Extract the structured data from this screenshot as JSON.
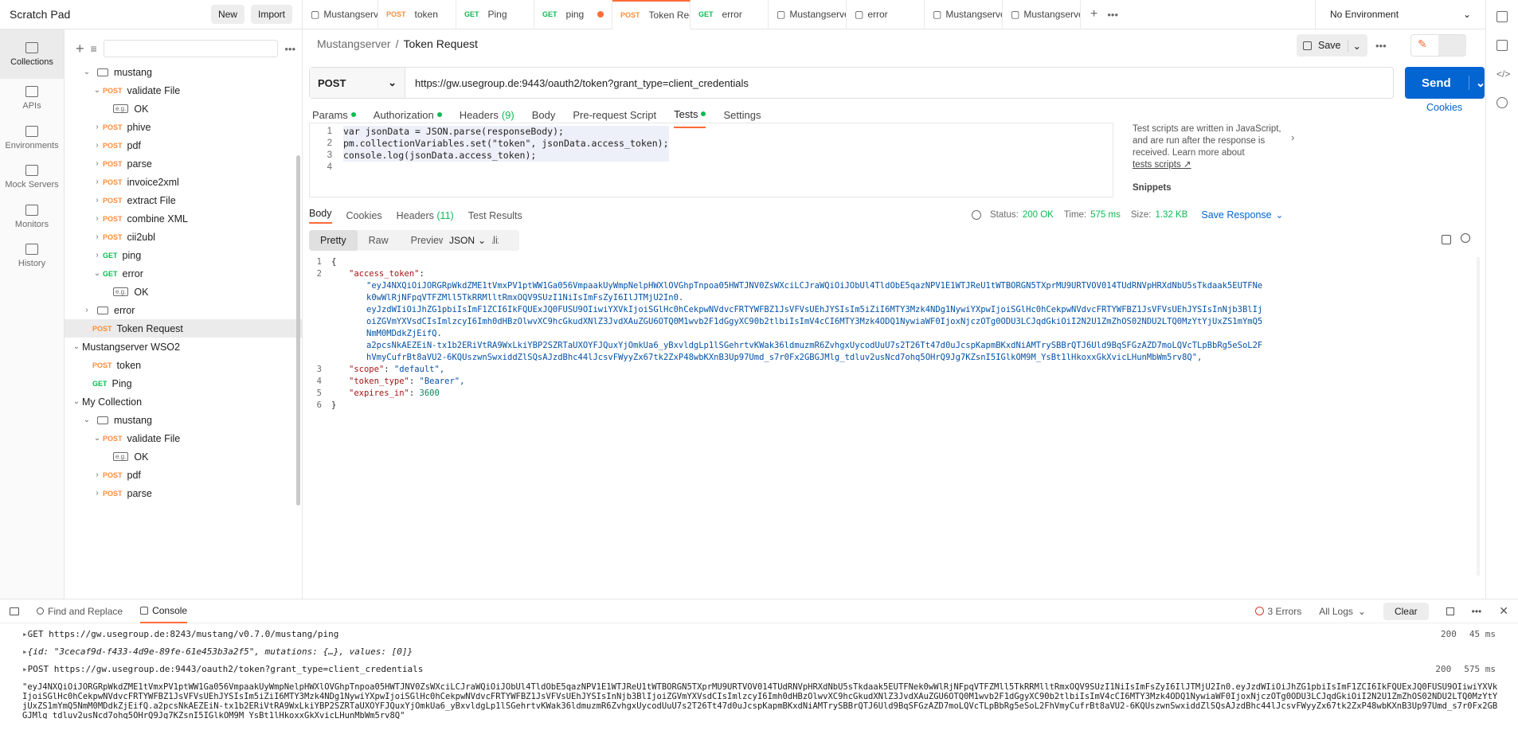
{
  "workspace": {
    "title": "Scratch Pad",
    "new_label": "New",
    "import_label": "Import"
  },
  "rail": [
    {
      "label": "Collections",
      "icon": "collections-icon"
    },
    {
      "label": "APIs",
      "icon": "apis-icon"
    },
    {
      "label": "Environments",
      "icon": "environments-icon"
    },
    {
      "label": "Mock Servers",
      "icon": "mock-servers-icon"
    },
    {
      "label": "Monitors",
      "icon": "monitors-icon"
    },
    {
      "label": "History",
      "icon": "history-icon"
    }
  ],
  "tree": [
    {
      "depth": 1,
      "chev": "v",
      "type": "folder",
      "label": "mustang"
    },
    {
      "depth": 2,
      "chev": "v",
      "method": "POST",
      "label": "validate File"
    },
    {
      "depth": 3,
      "chev": "",
      "type": "example",
      "label": "OK"
    },
    {
      "depth": 2,
      "chev": ">",
      "method": "POST",
      "label": "phive"
    },
    {
      "depth": 2,
      "chev": ">",
      "method": "POST",
      "label": "pdf"
    },
    {
      "depth": 2,
      "chev": ">",
      "method": "POST",
      "label": "parse"
    },
    {
      "depth": 2,
      "chev": ">",
      "method": "POST",
      "label": "invoice2xml"
    },
    {
      "depth": 2,
      "chev": ">",
      "method": "POST",
      "label": "extract File"
    },
    {
      "depth": 2,
      "chev": ">",
      "method": "POST",
      "label": "combine XML"
    },
    {
      "depth": 2,
      "chev": ">",
      "method": "POST",
      "label": "cii2ubl"
    },
    {
      "depth": 2,
      "chev": ">",
      "method": "GET",
      "label": "ping"
    },
    {
      "depth": 2,
      "chev": "v",
      "method": "GET",
      "label": "error"
    },
    {
      "depth": 3,
      "chev": "",
      "type": "example",
      "label": "OK"
    },
    {
      "depth": 1,
      "chev": ">",
      "type": "folder",
      "label": "error"
    },
    {
      "depth": 1,
      "chev": "",
      "method": "POST",
      "label": "Token Request",
      "selected": true
    },
    {
      "depth": 0,
      "chev": "v",
      "type": "collection",
      "label": "Mustangserver WSO2"
    },
    {
      "depth": 1,
      "chev": "",
      "method": "POST",
      "label": "token"
    },
    {
      "depth": 1,
      "chev": "",
      "method": "GET",
      "label": "Ping"
    },
    {
      "depth": 0,
      "chev": "v",
      "type": "collection",
      "label": "My Collection"
    },
    {
      "depth": 1,
      "chev": "v",
      "type": "folder",
      "label": "mustang"
    },
    {
      "depth": 2,
      "chev": "v",
      "method": "POST",
      "label": "validate File"
    },
    {
      "depth": 3,
      "chev": "",
      "type": "example",
      "label": "OK"
    },
    {
      "depth": 2,
      "chev": ">",
      "method": "POST",
      "label": "pdf"
    },
    {
      "depth": 2,
      "chev": ">",
      "method": "POST",
      "label": "parse"
    }
  ],
  "tabs": [
    {
      "method": "",
      "label": "Mustangserver",
      "icon": "collection-icon"
    },
    {
      "method": "POST",
      "label": "token"
    },
    {
      "method": "GET",
      "label": "Ping"
    },
    {
      "method": "GET",
      "label": "ping",
      "dot": true
    },
    {
      "method": "POST",
      "label": "Token Requ",
      "dot": true,
      "active": true
    },
    {
      "method": "GET",
      "label": "error"
    },
    {
      "method": "",
      "label": "Mustangserver",
      "icon": "collection-icon"
    },
    {
      "method": "",
      "label": "error",
      "icon": "folder-icon"
    },
    {
      "method": "",
      "label": "Mustangserver",
      "icon": "runner-icon"
    },
    {
      "method": "",
      "label": "Mustangserver",
      "icon": "runner-icon"
    }
  ],
  "environment": "No Environment",
  "breadcrumb": {
    "parent": "Mustangserver",
    "sep": "/",
    "current": "Token Request"
  },
  "save_label": "Save",
  "request": {
    "method": "POST",
    "url": "https://gw.usegroup.de:9443/oauth2/token?grant_type=client_credentials",
    "send_label": "Send"
  },
  "req_tabs": [
    {
      "label": "Params",
      "dot": true
    },
    {
      "label": "Authorization",
      "dot": true
    },
    {
      "label": "Headers",
      "count": "(9)"
    },
    {
      "label": "Body"
    },
    {
      "label": "Pre-request Script"
    },
    {
      "label": "Tests",
      "dot": true,
      "active": true
    },
    {
      "label": "Settings"
    }
  ],
  "cookies_label": "Cookies",
  "tests_code": [
    "var jsonData = JSON.parse(responseBody);",
    "pm.collectionVariables.set(\"token\", jsonData.access_token);",
    "console.log(jsonData.access_token);",
    ""
  ],
  "help": {
    "text": "Test scripts are written in JavaScript, and are run after the response is received. Learn more about",
    "link": "tests scripts ↗",
    "snippets": "Snippets"
  },
  "resp_tabs": [
    {
      "label": "Body",
      "active": true
    },
    {
      "label": "Cookies"
    },
    {
      "label": "Headers",
      "count": "(11)"
    },
    {
      "label": "Test Results"
    }
  ],
  "status": {
    "status_label": "Status:",
    "status": "200 OK",
    "time_label": "Time:",
    "time": "575 ms",
    "size_label": "Size:",
    "size": "1.32 KB",
    "save_resp": "Save Response"
  },
  "view_modes": [
    "Pretty",
    "Raw",
    "Preview",
    "Visualize"
  ],
  "format": "JSON",
  "response_lines": [
    {
      "n": "1",
      "text": "{"
    },
    {
      "n": "2",
      "key": "\"access_token\"",
      "value": ""
    },
    {
      "n": "",
      "value": "\"eyJ4NXQiOiJORGRpWkdZME1tVmxPV1ptWW1Ga056VmpaakUyWmpNelpHWXlOVGhpTnpoa05HWTJNV0ZsWXciLCJraWQiOiJObUl4TldObE5qazNPV1E1WTJReU1tWTBORGN5TXprMU9URTVOV014TUdRNVpHRXdNbU5sTkdaak5EUTFNek0wWlRjNFpqVTFZMll5TkRRMlltRmxOQV9SUzI1NiIsImFsZyI6IlJTMjU2In0."
    },
    {
      "n": "",
      "value": "eyJzdWIiOiJhZG1pbiIsImF1ZCI6IkFQUExJQ0FUSU9OIiwiYXVkIjoiSGlHc0hCekpwNVdvcFRTYWFBZ1JsVFVsUEhJYSIsIm5iZiI6MTY3Mzk4NDg1NywiYXpwIjoiSGlHc0hCekpwNVdvcFRTYWFBZ1JsVFVsUEhJYSIsInNjb3BlIjoiZGVmYXVsdCIsImlzcyI6Imh0dHBzOlwvXC9hcGkudXNlZ3JvdXAuZGU6OTQ0M1wvb2F1dGgyXC90b2tlbiIsImV4cCI6MTY3Mzk4ODQ1NywiaWF0IjoxNjczOTg0ODU3LCJqdGkiOiI2N2U1ZmZhOS02NDU2LTQ0MzYtYjUxZS1mYmQ5NmM0MDdkZjEifQ."
    },
    {
      "n": "",
      "value": "a2pcsNkAEZEiN-tx1b2ERiVtRA9WxLkiYBP2SZRTaUXOYFJQuxYjOmkUa6_yBxvldgLp1lSGehrtvKWak36ldmuzmR6ZvhgxUycodUuU7s2T26Tt47d0uJcspKapmBKxdNiAMTrySBBrQTJ6Uld9BqSFGzAZD7moLQVcTLpBbRg5eSoL2FhVmyCufrBt8aVU2-6KQUszwnSwxiddZlSQsAJzdBhc44lJcsvFWyyZx67tk2ZxP48wbKXnB3Up97Umd_s7r0Fx2GBGJMlg_tdluv2usNcd7ohq5OHrQ9Jg7KZsnI5IGlkOM9M_YsBt1lHkoxxGkXvicLHunMbWm5rv8Q\","
    },
    {
      "n": "3",
      "key": "\"scope\"",
      "value": "\"default\","
    },
    {
      "n": "4",
      "key": "\"token_type\"",
      "value": "\"Bearer\","
    },
    {
      "n": "5",
      "key": "\"expires_in\"",
      "number": "3600"
    },
    {
      "n": "6",
      "text": "}"
    }
  ],
  "console": {
    "find_label": "Find and Replace",
    "console_label": "Console",
    "errors": "3 Errors",
    "logs": "All Logs",
    "clear": "Clear",
    "entries": [
      {
        "text": "GET https://gw.usegroup.de:8243/mustang/v0.7.0/mustang/ping",
        "status": "200",
        "time": "45 ms"
      },
      {
        "obj": "{id: \"3cecaf9d-f433-4d9e-89fe-61e453b3a2f5\", mutations: {…}, values: [0]}"
      },
      {
        "text": "POST https://gw.usegroup.de:9443/oauth2/token?grant_type=client_credentials",
        "status": "200",
        "time": "575 ms"
      }
    ],
    "token_text": "\"eyJ4NXQiOiJORGRpWkdZME1tVmxPV1ptWW1Ga056VmpaakUyWmpNelpHWXlOVGhpTnpoa05HWTJNV0ZsWXciLCJraWQiOiJObUl4TldObE5qazNPV1E1WTJReU1tWTBORGN5TXprMU9URTVOV014TUdRNVpHRXdNbU5sTkdaak5EUTFNek0wWlRjNFpqVTFZMll5TkRRMlltRmxOQV9SUzI1NiIsImFsZyI6IlJTMjU2In0.eyJzdWIiOiJhZG1pbiIsImF1ZCI6IkFQUExJQ0FUSU9OIiwiYXVkIjoiSGlHc0hCekpwNVdvcFRTYWFBZ1JsVFVsUEhJYSIsIm5iZiI6MTY3Mzk4NDg1NywiYXpwIjoiSGlHc0hCekpwNVdvcFRTYWFBZ1JsVFVsUEhJYSIsInNjb3BlIjoiZGVmYXVsdCIsImlzcyI6Imh0dHBzOlwvXC9hcGkudXNlZ3JvdXAuZGU6OTQ0M1wvb2F1dGgyXC90b2tlbiIsImV4cCI6MTY3Mzk4ODQ1NywiaWF0IjoxNjczOTg0ODU3LCJqdGkiOiI2N2U1ZmZhOS02NDU2LTQ0MzYtYjUxZS1mYmQ5NmM0MDdkZjEifQ.a2pcsNkAEZEiN-tx1b2ERiVtRA9WxLkiYBP2SZRTaUXOYFJQuxYjOmkUa6_yBxvldgLp1lSGehrtvKWak36ldmuzmR6ZvhgxUycodUuU7s2T26Tt47d0uJcspKapmBKxdNiAMTrySBBrQTJ6Uld9BqSFGzAZD7moLQVcTLpBbRg5eSoL2FhVmyCufrBt8aVU2-6KQUszwnSwxiddZlSQsAJzdBhc44lJcsvFWyyZx67tk2ZxP48wbKXnB3Up97Umd_s7r0Fx2GBGJMlg_tdluv2usNcd7ohq5OHrQ9Jg7KZsnI5IGlkOM9M_YsBt1lHkoxxGkXvicLHunMbWm5rv8Q\""
  }
}
